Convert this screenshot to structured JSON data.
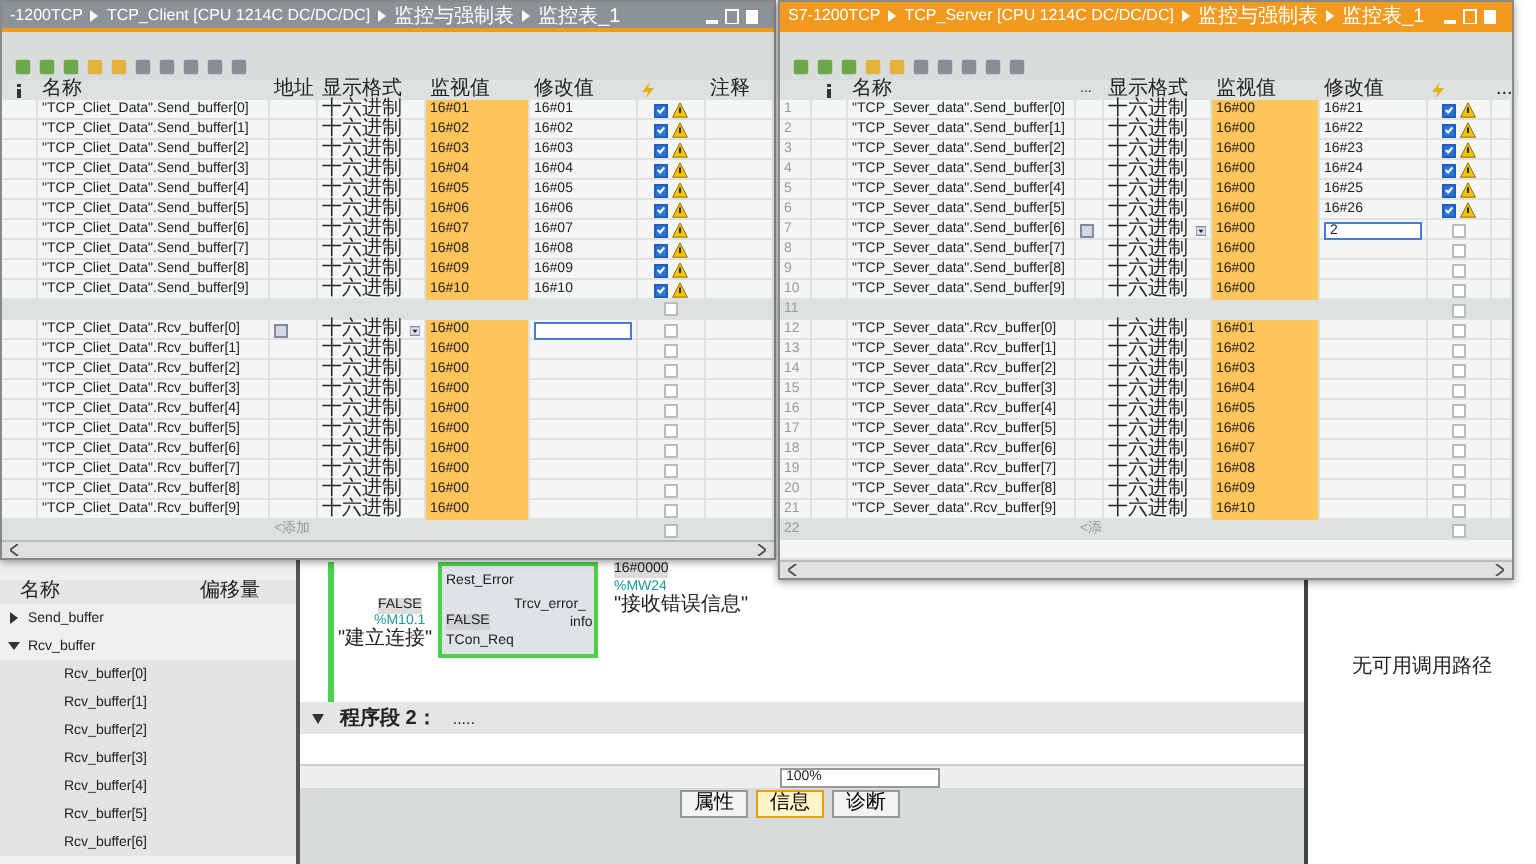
{
  "left_window": {
    "breadcrumb": [
      "-1200TCP",
      "TCP_Client [CPU 1214C DC/DC/DC]",
      "监控与强制表",
      "监控表_1"
    ],
    "columns": [
      "名称",
      "地址",
      "显示格式",
      "监视值",
      "修改值",
      "注释"
    ],
    "rows": [
      {
        "kind": "data",
        "name": "\"TCP_Cliet_Data\".Send_buffer[0]",
        "format": "十六进制",
        "monitor": "16#01",
        "modify": "16#01",
        "checked": true,
        "warning": true,
        "editing": false
      },
      {
        "kind": "data",
        "name": "\"TCP_Cliet_Data\".Send_buffer[1]",
        "format": "十六进制",
        "monitor": "16#02",
        "modify": "16#02",
        "checked": true,
        "warning": true,
        "editing": false
      },
      {
        "kind": "data",
        "name": "\"TCP_Cliet_Data\".Send_buffer[2]",
        "format": "十六进制",
        "monitor": "16#03",
        "modify": "16#03",
        "checked": true,
        "warning": true,
        "editing": false
      },
      {
        "kind": "data",
        "name": "\"TCP_Cliet_Data\".Send_buffer[3]",
        "format": "十六进制",
        "monitor": "16#04",
        "modify": "16#04",
        "checked": true,
        "warning": true,
        "editing": false
      },
      {
        "kind": "data",
        "name": "\"TCP_Cliet_Data\".Send_buffer[4]",
        "format": "十六进制",
        "monitor": "16#05",
        "modify": "16#05",
        "checked": true,
        "warning": true,
        "editing": false
      },
      {
        "kind": "data",
        "name": "\"TCP_Cliet_Data\".Send_buffer[5]",
        "format": "十六进制",
        "monitor": "16#06",
        "modify": "16#06",
        "checked": true,
        "warning": true,
        "editing": false
      },
      {
        "kind": "data",
        "name": "\"TCP_Cliet_Data\".Send_buffer[6]",
        "format": "十六进制",
        "monitor": "16#07",
        "modify": "16#07",
        "checked": true,
        "warning": true,
        "editing": false
      },
      {
        "kind": "data",
        "name": "\"TCP_Cliet_Data\".Send_buffer[7]",
        "format": "十六进制",
        "monitor": "16#08",
        "modify": "16#08",
        "checked": true,
        "warning": true,
        "editing": false
      },
      {
        "kind": "data",
        "name": "\"TCP_Cliet_Data\".Send_buffer[8]",
        "format": "十六进制",
        "monitor": "16#09",
        "modify": "16#09",
        "checked": true,
        "warning": true,
        "editing": false
      },
      {
        "kind": "data",
        "name": "\"TCP_Cliet_Data\".Send_buffer[9]",
        "format": "十六进制",
        "monitor": "16#10",
        "modify": "16#10",
        "checked": true,
        "warning": true,
        "editing": false
      },
      {
        "kind": "blank",
        "checked": false
      },
      {
        "kind": "data",
        "name": "\"TCP_Cliet_Data\".Rcv_buffer[0]",
        "format": "十六进制",
        "monitor": "16#00",
        "checked": false,
        "warning": false,
        "editing": true
      },
      {
        "kind": "data",
        "name": "\"TCP_Cliet_Data\".Rcv_buffer[1]",
        "format": "十六进制",
        "monitor": "16#00",
        "checked": false,
        "warning": false,
        "editing": false
      },
      {
        "kind": "data",
        "name": "\"TCP_Cliet_Data\".Rcv_buffer[2]",
        "format": "十六进制",
        "monitor": "16#00",
        "checked": false,
        "warning": false,
        "editing": false
      },
      {
        "kind": "data",
        "name": "\"TCP_Cliet_Data\".Rcv_buffer[3]",
        "format": "十六进制",
        "monitor": "16#00",
        "checked": false,
        "warning": false,
        "editing": false
      },
      {
        "kind": "data",
        "name": "\"TCP_Cliet_Data\".Rcv_buffer[4]",
        "format": "十六进制",
        "monitor": "16#00",
        "checked": false,
        "warning": false,
        "editing": false
      },
      {
        "kind": "data",
        "name": "\"TCP_Cliet_Data\".Rcv_buffer[5]",
        "format": "十六进制",
        "monitor": "16#00",
        "checked": false,
        "warning": false,
        "editing": false
      },
      {
        "kind": "data",
        "name": "\"TCP_Cliet_Data\".Rcv_buffer[6]",
        "format": "十六进制",
        "monitor": "16#00",
        "checked": false,
        "warning": false,
        "editing": false
      },
      {
        "kind": "data",
        "name": "\"TCP_Cliet_Data\".Rcv_buffer[7]",
        "format": "十六进制",
        "monitor": "16#00",
        "checked": false,
        "warning": false,
        "editing": false
      },
      {
        "kind": "data",
        "name": "\"TCP_Cliet_Data\".Rcv_buffer[8]",
        "format": "十六进制",
        "monitor": "16#00",
        "checked": false,
        "warning": false,
        "editing": false
      },
      {
        "kind": "data",
        "name": "\"TCP_Cliet_Data\".Rcv_buffer[9]",
        "format": "十六进制",
        "monitor": "16#00",
        "checked": false,
        "warning": false,
        "editing": false
      },
      {
        "kind": "add",
        "add_label": "<添加",
        "checked": false
      }
    ]
  },
  "right_window": {
    "breadcrumb": [
      "S7-1200TCP",
      "TCP_Server [CPU 1214C DC/DC/DC]",
      "监控与强制表",
      "监控表_1"
    ],
    "columns": [
      "名称",
      "...",
      "显示格式",
      "监视值",
      "修改值",
      "..."
    ],
    "rows": [
      {
        "kind": "data",
        "number": "1",
        "name": "\"TCP_Sever_data\".Send_buffer[0]",
        "format": "十六进制",
        "monitor": "16#00",
        "modify": "16#21",
        "checked": true,
        "warning": true,
        "editing": false
      },
      {
        "kind": "data",
        "number": "2",
        "name": "\"TCP_Sever_data\".Send_buffer[1]",
        "format": "十六进制",
        "monitor": "16#00",
        "modify": "16#22",
        "checked": true,
        "warning": true,
        "editing": false
      },
      {
        "kind": "data",
        "number": "3",
        "name": "\"TCP_Sever_data\".Send_buffer[2]",
        "format": "十六进制",
        "monitor": "16#00",
        "modify": "16#23",
        "checked": true,
        "warning": true,
        "editing": false
      },
      {
        "kind": "data",
        "number": "4",
        "name": "\"TCP_Sever_data\".Send_buffer[3]",
        "format": "十六进制",
        "monitor": "16#00",
        "modify": "16#24",
        "checked": true,
        "warning": true,
        "editing": false
      },
      {
        "kind": "data",
        "number": "5",
        "name": "\"TCP_Sever_data\".Send_buffer[4]",
        "format": "十六进制",
        "monitor": "16#00",
        "modify": "16#25",
        "checked": true,
        "warning": true,
        "editing": false
      },
      {
        "kind": "data",
        "number": "6",
        "name": "\"TCP_Sever_data\".Send_buffer[5]",
        "format": "十六进制",
        "monitor": "16#00",
        "modify": "16#26",
        "checked": true,
        "warning": true,
        "editing": false
      },
      {
        "kind": "data",
        "number": "7",
        "name": "\"TCP_Sever_data\".Send_buffer[6]",
        "format": "十六进制",
        "monitor": "16#00",
        "modify": "2",
        "checked": false,
        "warning": false,
        "editing": true
      },
      {
        "kind": "data",
        "number": "8",
        "name": "\"TCP_Sever_data\".Send_buffer[7]",
        "format": "十六进制",
        "monitor": "16#00",
        "checked": false,
        "warning": false,
        "editing": false
      },
      {
        "kind": "data",
        "number": "9",
        "name": "\"TCP_Sever_data\".Send_buffer[8]",
        "format": "十六进制",
        "monitor": "16#00",
        "checked": false,
        "warning": false,
        "editing": false
      },
      {
        "kind": "data",
        "number": "10",
        "name": "\"TCP_Sever_data\".Send_buffer[9]",
        "format": "十六进制",
        "monitor": "16#00",
        "checked": false,
        "warning": false,
        "editing": false
      },
      {
        "kind": "blank",
        "number": "11",
        "checked": false
      },
      {
        "kind": "data",
        "number": "12",
        "name": "\"TCP_Sever_data\".Rcv_buffer[0]",
        "format": "十六进制",
        "monitor": "16#01",
        "checked": false,
        "warning": false,
        "editing": false
      },
      {
        "kind": "data",
        "number": "13",
        "name": "\"TCP_Sever_data\".Rcv_buffer[1]",
        "format": "十六进制",
        "monitor": "16#02",
        "checked": false,
        "warning": false,
        "editing": false
      },
      {
        "kind": "data",
        "number": "14",
        "name": "\"TCP_Sever_data\".Rcv_buffer[2]",
        "format": "十六进制",
        "monitor": "16#03",
        "checked": false,
        "warning": false,
        "editing": false
      },
      {
        "kind": "data",
        "number": "15",
        "name": "\"TCP_Sever_data\".Rcv_buffer[3]",
        "format": "十六进制",
        "monitor": "16#04",
        "checked": false,
        "warning": false,
        "editing": false
      },
      {
        "kind": "data",
        "number": "16",
        "name": "\"TCP_Sever_data\".Rcv_buffer[4]",
        "format": "十六进制",
        "monitor": "16#05",
        "checked": false,
        "warning": false,
        "editing": false
      },
      {
        "kind": "data",
        "number": "17",
        "name": "\"TCP_Sever_data\".Rcv_buffer[5]",
        "format": "十六进制",
        "monitor": "16#06",
        "checked": false,
        "warning": false,
        "editing": false
      },
      {
        "kind": "data",
        "number": "18",
        "name": "\"TCP_Sever_data\".Rcv_buffer[6]",
        "format": "十六进制",
        "monitor": "16#07",
        "checked": false,
        "warning": false,
        "editing": false
      },
      {
        "kind": "data",
        "number": "19",
        "name": "\"TCP_Sever_data\".Rcv_buffer[7]",
        "format": "十六进制",
        "monitor": "16#08",
        "checked": false,
        "warning": false,
        "editing": false
      },
      {
        "kind": "data",
        "number": "20",
        "name": "\"TCP_Sever_data\".Rcv_buffer[8]",
        "format": "十六进制",
        "monitor": "16#09",
        "checked": false,
        "warning": false,
        "editing": false
      },
      {
        "kind": "data",
        "number": "21",
        "name": "\"TCP_Sever_data\".Rcv_buffer[9]",
        "format": "十六进制",
        "monitor": "16#10",
        "checked": false,
        "warning": false,
        "editing": false
      },
      {
        "kind": "add",
        "number": "22",
        "add_label": "<添",
        "checked": false
      }
    ]
  },
  "tree": {
    "columns": [
      "名称",
      "偏移量"
    ],
    "items": [
      {
        "label": "Send_buffer",
        "expanded": false
      },
      {
        "label": "Rcv_buffer",
        "expanded": true,
        "children": [
          {
            "label": "Rcv_buffer[0]"
          },
          {
            "label": "Rcv_buffer[1]"
          },
          {
            "label": "Rcv_buffer[2]"
          },
          {
            "label": "Rcv_buffer[3]"
          },
          {
            "label": "Rcv_buffer[4]"
          },
          {
            "label": "Rcv_buffer[5]"
          },
          {
            "label": "Rcv_buffer[6]"
          }
        ]
      }
    ]
  },
  "ladder": {
    "pin_in_1": "Rest_Error",
    "pin_in_2_value": "FALSE",
    "pin_in_2_address": "%M10.1",
    "pin_in_2_symbol": "\"建立连接\"",
    "pin_in_2_state": "FALSE",
    "pin_in_2": "TCon_Req",
    "pin_out_1": "Trcv_error_",
    "pin_out_2": "info",
    "out_value": "16#0000",
    "out_address": "%MW24",
    "out_symbol": "\"接收错误信息\"",
    "network_title": "程序段 2：",
    "network_comment": "....."
  },
  "zoom": {
    "value": "100%"
  },
  "bottom_tabs": [
    {
      "label": "属性",
      "selected": false
    },
    {
      "label": "信息",
      "selected": true
    },
    {
      "label": "诊断",
      "selected": false
    }
  ],
  "call_panel": {
    "message": "无可用调用路径"
  }
}
